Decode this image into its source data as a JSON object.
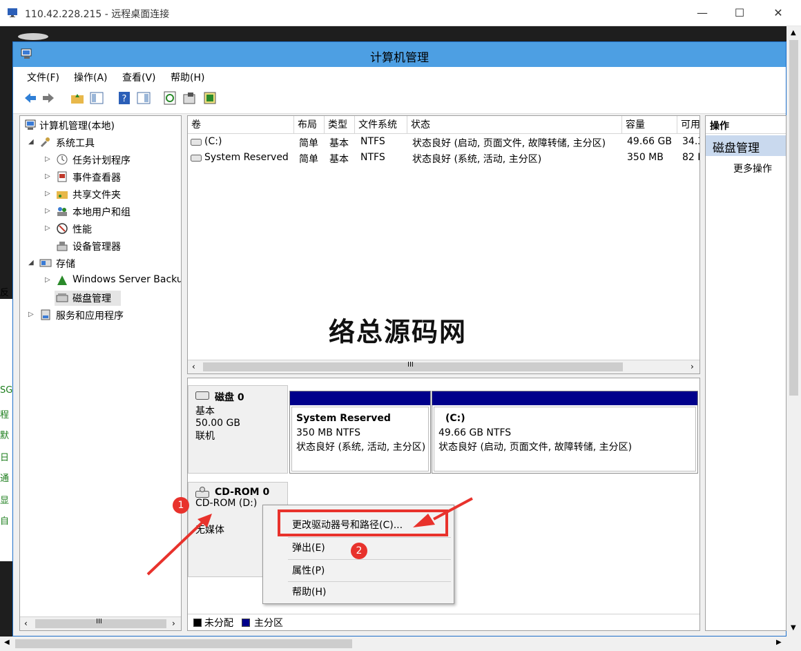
{
  "rdp": {
    "title": "110.42.228.215 - 远程桌面连接",
    "minimize_glyph": "—",
    "maximize_glyph": "☐",
    "close_glyph": "✕"
  },
  "desktop_fragments": [
    "反",
    "SG",
    "程",
    "默",
    "日",
    "通",
    "显",
    "自"
  ],
  "window": {
    "title": "计算机管理"
  },
  "menu": [
    "文件(F)",
    "操作(A)",
    "查看(V)",
    "帮助(H)"
  ],
  "toolbar": {
    "icons": [
      "back-arrow-icon",
      "forward-arrow-icon",
      "up-folder-icon",
      "show-hide-tree-icon",
      "help-icon",
      "show-hide-action-icon",
      "refresh-icon",
      "properties-icon",
      "export-icon"
    ]
  },
  "tree": {
    "items": [
      {
        "label": "计算机管理(本地)",
        "expander": ""
      },
      {
        "label": "系统工具",
        "expander": "◢"
      },
      {
        "label": "任务计划程序",
        "expander": "▷"
      },
      {
        "label": "事件查看器",
        "expander": "▷"
      },
      {
        "label": "共享文件夹",
        "expander": "▷"
      },
      {
        "label": "本地用户和组",
        "expander": "▷"
      },
      {
        "label": "性能",
        "expander": "▷"
      },
      {
        "label": "设备管理器",
        "expander": ""
      },
      {
        "label": "存储",
        "expander": "◢"
      },
      {
        "label": "Windows Server Backup",
        "expander": "▷"
      },
      {
        "label": "磁盘管理",
        "expander": ""
      },
      {
        "label": "服务和应用程序",
        "expander": "▷"
      }
    ]
  },
  "volumes": {
    "columns": [
      "卷",
      "布局",
      "类型",
      "文件系统",
      "状态",
      "容量",
      "可用"
    ],
    "rows": [
      [
        "(C:)",
        "简单",
        "基本",
        "NTFS",
        "状态良好 (启动, 页面文件, 故障转储, 主分区)",
        "49.66 GB",
        "34.3"
      ],
      [
        "System Reserved",
        "简单",
        "基本",
        "NTFS",
        "状态良好 (系统, 活动, 主分区)",
        "350 MB",
        "82 I"
      ]
    ],
    "scroll_thumb": "III"
  },
  "watermark": "络总源码网",
  "disks": {
    "disk0": {
      "name": "磁盘 0",
      "type": "基本",
      "size": "50.00 GB",
      "status": "联机",
      "partitions": [
        {
          "name": "System Reserved",
          "size": "350 MB NTFS",
          "status": "状态良好 (系统, 活动, 主分区)"
        },
        {
          "name": "(C:)",
          "size": "49.66 GB NTFS",
          "status": "状态良好 (启动, 页面文件, 故障转储, 主分区)"
        }
      ]
    },
    "cdrom": {
      "name": "CD-ROM 0",
      "drive": "CD-ROM (D:)",
      "media": "无媒体"
    }
  },
  "legend": {
    "items": [
      {
        "label": "未分配",
        "color": "#000000"
      },
      {
        "label": "主分区",
        "color": "#00008b"
      }
    ]
  },
  "actions": {
    "header": "操作",
    "section": "磁盘管理",
    "more": "更多操作"
  },
  "context_menu": {
    "items": [
      "更改驱动器号和路径(C)...",
      "弹出(E)",
      "属性(P)",
      "帮助(H)"
    ]
  },
  "annotations": {
    "badge1": "1",
    "badge2": "2",
    "color": "#e8322c"
  }
}
